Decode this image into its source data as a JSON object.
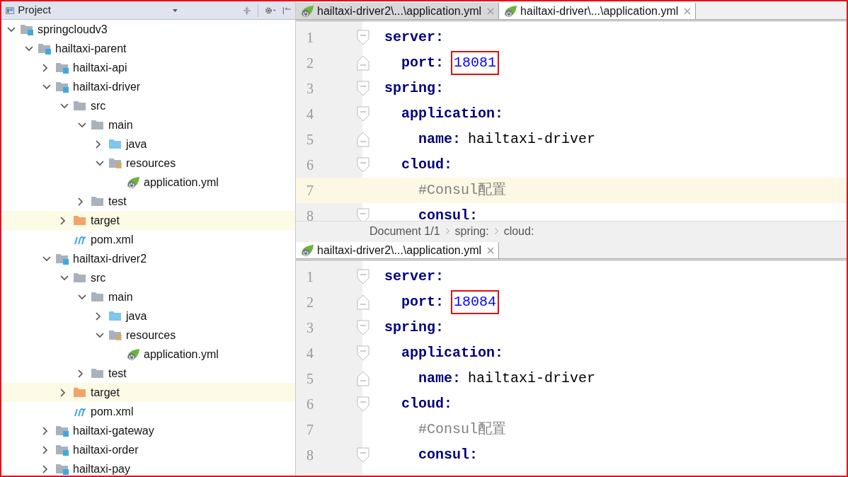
{
  "project_panel": {
    "title": "Project",
    "tree": [
      {
        "label": "springcloudv3",
        "kind": "module",
        "expanded": true,
        "highlighted": false,
        "children": [
          {
            "label": "hailtaxi-parent",
            "kind": "module",
            "expanded": true,
            "highlighted": false,
            "children": [
              {
                "label": "hailtaxi-api",
                "kind": "module",
                "expanded": false,
                "highlighted": false
              },
              {
                "label": "hailtaxi-driver",
                "kind": "module",
                "expanded": true,
                "highlighted": false,
                "children": [
                  {
                    "label": "src",
                    "kind": "folder",
                    "expanded": true,
                    "highlighted": false,
                    "children": [
                      {
                        "label": "main",
                        "kind": "folder",
                        "expanded": true,
                        "highlighted": false,
                        "children": [
                          {
                            "label": "java",
                            "kind": "source-folder",
                            "expanded": false,
                            "highlighted": false
                          },
                          {
                            "label": "resources",
                            "kind": "resource-folder",
                            "expanded": true,
                            "highlighted": false,
                            "children": [
                              {
                                "label": "application.yml",
                                "kind": "yml",
                                "highlighted": false
                              }
                            ]
                          }
                        ]
                      },
                      {
                        "label": "test",
                        "kind": "folder",
                        "expanded": false,
                        "highlighted": false
                      }
                    ]
                  },
                  {
                    "label": "target",
                    "kind": "excluded-folder",
                    "expanded": false,
                    "highlighted": true
                  },
                  {
                    "label": "pom.xml",
                    "kind": "maven",
                    "highlighted": false
                  }
                ]
              },
              {
                "label": "hailtaxi-driver2",
                "kind": "module",
                "expanded": true,
                "highlighted": false,
                "children": [
                  {
                    "label": "src",
                    "kind": "folder",
                    "expanded": true,
                    "highlighted": false,
                    "children": [
                      {
                        "label": "main",
                        "kind": "folder",
                        "expanded": true,
                        "highlighted": false,
                        "children": [
                          {
                            "label": "java",
                            "kind": "source-folder",
                            "expanded": false,
                            "highlighted": false
                          },
                          {
                            "label": "resources",
                            "kind": "resource-folder",
                            "expanded": true,
                            "highlighted": false,
                            "children": [
                              {
                                "label": "application.yml",
                                "kind": "yml",
                                "highlighted": false
                              }
                            ]
                          }
                        ]
                      },
                      {
                        "label": "test",
                        "kind": "folder",
                        "expanded": false,
                        "highlighted": false
                      }
                    ]
                  },
                  {
                    "label": "target",
                    "kind": "excluded-folder",
                    "expanded": false,
                    "highlighted": true
                  },
                  {
                    "label": "pom.xml",
                    "kind": "maven",
                    "highlighted": false
                  }
                ]
              },
              {
                "label": "hailtaxi-gateway",
                "kind": "module",
                "expanded": false,
                "highlighted": false
              },
              {
                "label": "hailtaxi-order",
                "kind": "module",
                "expanded": false,
                "highlighted": false
              },
              {
                "label": "hailtaxi-pay",
                "kind": "module",
                "expanded": false,
                "highlighted": false
              }
            ]
          }
        ]
      }
    ]
  },
  "editors": [
    {
      "tabs": [
        {
          "label": "hailtaxi-driver2\\...\\application.yml",
          "selected": false
        },
        {
          "label": "hailtaxi-driver\\...\\application.yml",
          "selected": true
        }
      ],
      "lines": [
        {
          "number": "1",
          "fold_start": true,
          "fold_end": false,
          "current": false,
          "tokens": [
            {
              "kind": "key",
              "text": "server:"
            }
          ]
        },
        {
          "number": "2",
          "fold_start": false,
          "fold_end": true,
          "current": false,
          "tokens": [
            {
              "kind": "key",
              "text": "  port:"
            },
            {
              "kind": "number",
              "text": "18081",
              "boxed": true
            }
          ]
        },
        {
          "number": "3",
          "fold_start": true,
          "fold_end": false,
          "current": false,
          "tokens": [
            {
              "kind": "key",
              "text": "spring:"
            }
          ]
        },
        {
          "number": "4",
          "fold_start": true,
          "fold_end": false,
          "current": false,
          "tokens": [
            {
              "kind": "key",
              "text": "  application:"
            }
          ]
        },
        {
          "number": "5",
          "fold_start": false,
          "fold_end": true,
          "current": false,
          "tokens": [
            {
              "kind": "key",
              "text": "    name:"
            },
            {
              "kind": "text",
              "text": "hailtaxi-driver"
            }
          ]
        },
        {
          "number": "6",
          "fold_start": true,
          "fold_end": false,
          "current": false,
          "tokens": [
            {
              "kind": "key",
              "text": "  cloud:"
            }
          ]
        },
        {
          "number": "7",
          "fold_start": false,
          "fold_end": false,
          "current": true,
          "tokens": [
            {
              "kind": "comment",
              "text": "    #Consul配置"
            }
          ]
        },
        {
          "number": "8",
          "fold_start": true,
          "fold_end": false,
          "current": false,
          "tokens": [
            {
              "kind": "key",
              "text": "    consul:"
            }
          ]
        }
      ],
      "breadcrumb": [
        "Document 1/1",
        "spring:",
        "cloud:"
      ]
    },
    {
      "tabs": [
        {
          "label": "hailtaxi-driver2\\...\\application.yml",
          "selected": true
        }
      ],
      "lines": [
        {
          "number": "1",
          "fold_start": true,
          "fold_end": false,
          "current": false,
          "tokens": [
            {
              "kind": "key",
              "text": "server:"
            }
          ]
        },
        {
          "number": "2",
          "fold_start": false,
          "fold_end": true,
          "current": false,
          "tokens": [
            {
              "kind": "key",
              "text": "  port:"
            },
            {
              "kind": "number",
              "text": "18084",
              "boxed": true
            }
          ]
        },
        {
          "number": "3",
          "fold_start": true,
          "fold_end": false,
          "current": false,
          "tokens": [
            {
              "kind": "key",
              "text": "spring:"
            }
          ]
        },
        {
          "number": "4",
          "fold_start": true,
          "fold_end": false,
          "current": false,
          "tokens": [
            {
              "kind": "key",
              "text": "  application:"
            }
          ]
        },
        {
          "number": "5",
          "fold_start": false,
          "fold_end": true,
          "current": false,
          "tokens": [
            {
              "kind": "key",
              "text": "    name:"
            },
            {
              "kind": "text",
              "text": "hailtaxi-driver"
            }
          ]
        },
        {
          "number": "6",
          "fold_start": true,
          "fold_end": false,
          "current": false,
          "tokens": [
            {
              "kind": "key",
              "text": "  cloud:"
            }
          ]
        },
        {
          "number": "7",
          "fold_start": false,
          "fold_end": false,
          "current": false,
          "tokens": [
            {
              "kind": "comment",
              "text": "    #Consul配置"
            }
          ]
        },
        {
          "number": "8",
          "fold_start": true,
          "fold_end": false,
          "current": false,
          "tokens": [
            {
              "kind": "key",
              "text": "    consul:"
            }
          ]
        }
      ]
    }
  ]
}
